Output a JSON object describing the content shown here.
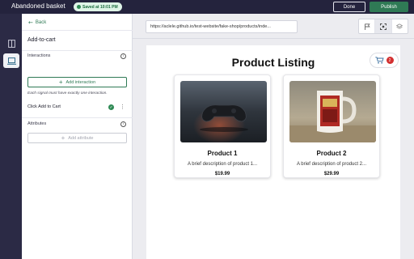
{
  "topbar": {
    "title": "Abandoned basket",
    "saved_badge": "Saved at 10:01 PM",
    "done_label": "Done",
    "publish_label": "Publish"
  },
  "rail": {
    "items": [
      {
        "icon": "pages-icon"
      },
      {
        "icon": "screen-icon",
        "active": true
      }
    ]
  },
  "panel": {
    "back_label": "Back",
    "title": "Add-to-cart",
    "interactions": {
      "label": "Interactions",
      "add_label": "Add interaction",
      "note": "Each signal must have exactly one interaction.",
      "signal_label": "Click Add to Cart"
    },
    "attributes": {
      "label": "Attributes",
      "add_label": "Add attribute"
    }
  },
  "preview": {
    "url": "https://aclele.github.io/test-website/fake-shop/products/inde...",
    "tools": [
      "flag-icon",
      "select-target-icon",
      "layers-icon"
    ],
    "page": {
      "title": "Product Listing",
      "cart_count": "2",
      "products": [
        {
          "name": "Product 1",
          "description": "A brief description of product 1...",
          "price": "$19.99",
          "image": "game-controller"
        },
        {
          "name": "Product 2",
          "description": "A brief description of product 2...",
          "price": "$29.99",
          "image": "coffee-mug"
        }
      ]
    }
  },
  "colors": {
    "accent": "#2f7a55",
    "topbar": "#24233d",
    "badge_bg": "#dff4e7",
    "cart_badge": "#d32f2f"
  }
}
